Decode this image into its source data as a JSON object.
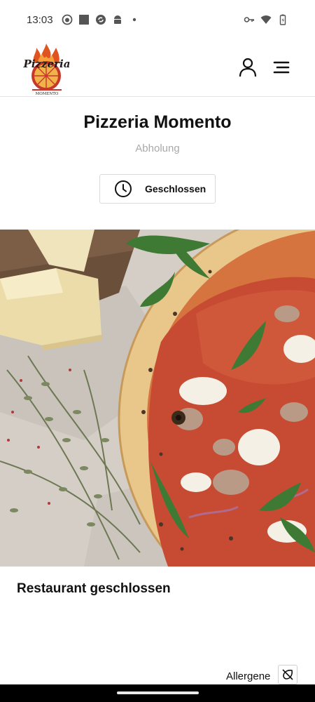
{
  "status_bar": {
    "time": "13:03",
    "left_icons": [
      "face-icon",
      "square-icon",
      "sync-icon",
      "android-icon",
      "dot-icon"
    ],
    "right_icons": [
      "vpn-key-icon",
      "wifi-icon",
      "battery-icon"
    ]
  },
  "header": {
    "logo_text": "Pizzeria",
    "logo_subtext": "MOMENTO",
    "user_icon": "user-icon",
    "menu_icon": "hamburger-menu-icon"
  },
  "restaurant": {
    "name": "Pizzeria Momento",
    "mode": "Abholung",
    "status_label": "Geschlossen",
    "status_icon": "clock-icon"
  },
  "hero": {
    "image": "pizza-photo"
  },
  "notice": {
    "text": "Restaurant geschlossen"
  },
  "footer": {
    "allergene_label": "Allergene",
    "allergene_icon": "allergen-icon"
  },
  "colors": {
    "accent": "#d2422b",
    "subtitle": "#a9a9a9",
    "border": "#d9d9d9"
  }
}
